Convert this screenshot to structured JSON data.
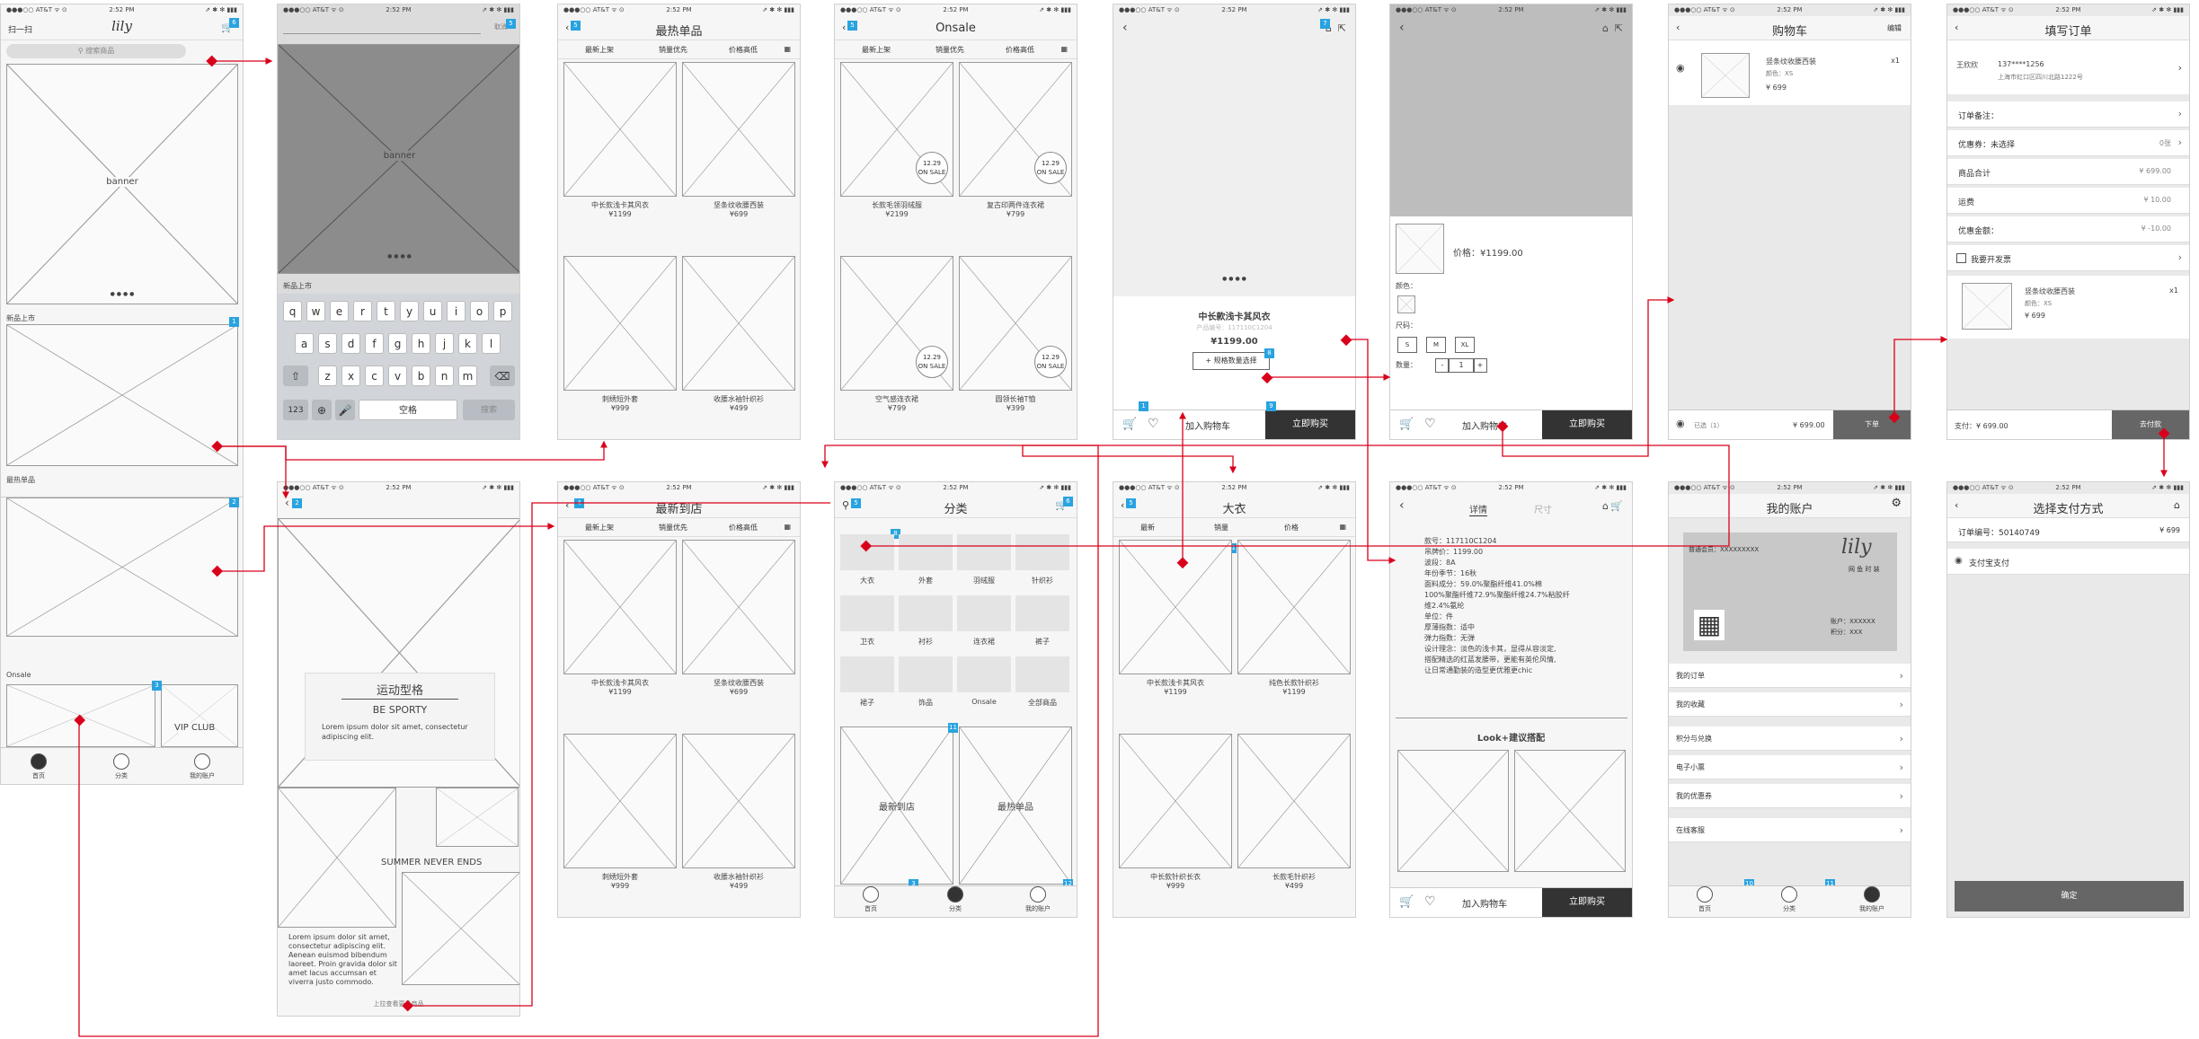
{
  "status": {
    "carrier": "●●●○○ AT&T ᯤ ⊙",
    "time": "2:52 PM",
    "battery": "⇗ ✱ ✻ ▮▮▮"
  },
  "s1": {
    "nav_left": "扫一扫",
    "logo": "lily",
    "search_placeholder": "搜索商品",
    "banner": "banner",
    "sec_new": "新品上市",
    "sec_hot": "最热单品",
    "sec_onsale": "Onsale",
    "vip": "VIP CLUB",
    "tabs": [
      "首页",
      "分类",
      "我的账户"
    ]
  },
  "s2": {
    "banner": "banner",
    "sec_new": "新品上市",
    "search_btn": "搜索",
    "cancel": "取消",
    "keys_r1": [
      "q",
      "w",
      "e",
      "r",
      "t",
      "y",
      "u",
      "i",
      "o",
      "p"
    ],
    "keys_r2": [
      "a",
      "s",
      "d",
      "f",
      "g",
      "h",
      "j",
      "k",
      "l"
    ],
    "keys_r3": [
      "z",
      "x",
      "c",
      "v",
      "b",
      "n",
      "m"
    ],
    "k123": "123",
    "space": "空格"
  },
  "s3": {
    "title": "最热单品",
    "sort": [
      "最新上架",
      "销量优先",
      "价格高低"
    ],
    "items": [
      {
        "name": "中长款浅卡其风衣",
        "price": "¥1199"
      },
      {
        "name": "坚条纹收腰西装",
        "price": "¥699"
      },
      {
        "name": "刺绣短外套",
        "price": "¥999"
      },
      {
        "name": "收腰水袖针织衫",
        "price": "¥499"
      }
    ]
  },
  "s4": {
    "title": "Onsale",
    "sort": [
      "最新上架",
      "销量优先",
      "价格高低"
    ],
    "sale_date": "12.29",
    "sale_label": "ON SALE",
    "items": [
      {
        "name": "长款毛领羽绒服",
        "price": "¥2199"
      },
      {
        "name": "复古印两件连衣裙",
        "price": "¥799"
      },
      {
        "name": "空气感连衣裙",
        "price": "¥799"
      },
      {
        "name": "圆领长袖T恤",
        "price": "¥399"
      }
    ]
  },
  "s5": {
    "product": "中长款浅卡其风衣",
    "code": "产品编号：117110C1204",
    "price": "¥1199.00",
    "spec_btn": "+ 规格数量选择",
    "add_cart": "加入购物车",
    "buy": "立即购买"
  },
  "s6": {
    "price": "价格：¥1199.00",
    "color_label": "颜色：",
    "size_label": "尺码：",
    "sizes": [
      "S",
      "M",
      "XL"
    ],
    "qty_label": "数量：",
    "qty": "1",
    "minus": "-",
    "plus": "+",
    "add_cart": "加入购物车",
    "buy": "立即购买"
  },
  "s7": {
    "title": "购物车",
    "edit": "编辑",
    "item_name": "竖条纹收腰西装",
    "item_spec": "颜色：XS",
    "item_qty": "x1",
    "item_price": "¥ 699",
    "selected": "已选（1）",
    "total": "¥ 699.00",
    "order_btn": "下单"
  },
  "s8": {
    "title": "填写订单",
    "receiver": "王欣欣",
    "phone": "137****1256",
    "address": "上海市虹口区四川北路1222号",
    "rows": [
      {
        "k": "订单备注：",
        "v": ""
      },
      {
        "k": "优惠券：未选择",
        "v": "0张"
      },
      {
        "k": "商品合计",
        "v": "¥ 699.00"
      },
      {
        "k": "运费",
        "v": "¥ 10.00"
      },
      {
        "k": "优惠金额：",
        "v": "¥ -10.00"
      }
    ],
    "invoice": "我要开发票",
    "item_name": "竖条纹收腰西装",
    "item_spec": "颜色：XS",
    "item_qty": "x1",
    "item_price": "¥ 699",
    "pay_total": "支付：¥ 699.00",
    "pay_btn": "去付款"
  },
  "s9": {
    "title": "最新到店",
    "sort": [
      "最新上架",
      "销量优先",
      "价格高低"
    ],
    "items": [
      {
        "name": "中长款浅卡其风衣",
        "price": "¥1199"
      },
      {
        "name": "坚条纹收腰西装",
        "price": "¥699"
      },
      {
        "name": "刺绣短外套",
        "price": "¥999"
      },
      {
        "name": "收腰水袖针织衫",
        "price": "¥499"
      }
    ]
  },
  "s10": {
    "title": "运动型格",
    "subtitle": "BE SPORTY",
    "lorem1": "Lorem ipsum dolor sit amet, consectetur adipiscing elit.",
    "summer": "SUMMER NEVER ENDS",
    "lorem2": "Lorem ipsum dolor sit amet, consectetur adipiscing elit. Aenean euismod bibendum laoreet. Proin gravida dolor sit amet lacus accumsan et viverra justo commodo.",
    "more": "上拉查看更多商品"
  },
  "s11": {
    "title": "分类",
    "cats": [
      "大衣",
      "外套",
      "羽绒服",
      "针织衫",
      "卫衣",
      "衬衫",
      "连衣裙",
      "裤子",
      "裙子",
      "饰品",
      "Onsale",
      "全部商品"
    ],
    "promo1": "最新到店",
    "promo2": "最热单品",
    "tabs": [
      "首页",
      "分类",
      "我的账户"
    ]
  },
  "s12": {
    "title": "大衣",
    "sort": [
      "最新",
      "销量",
      "价格"
    ],
    "items": [
      {
        "name": "中长款浅卡其风衣",
        "price": "¥1199"
      },
      {
        "name": "纯色长款针织衫",
        "price": "¥1199"
      },
      {
        "name": "中长款针织长衣",
        "price": "¥999"
      },
      {
        "name": "长款毛针织衫",
        "price": "¥499"
      }
    ]
  },
  "s13": {
    "tab1": "详情",
    "tab2": "尺寸",
    "details": [
      "款号：117110C1204",
      "吊牌价：1199.00",
      "波段：8A",
      "年份季节：16秋",
      "面料成分：59.0%聚酯纤维41.0%棉",
      "100%聚酯纤维72.9%聚酯纤维24.7%粘胶纤",
      "维2.4%氨纶",
      "单位：件",
      "厚薄指数：适中",
      "弹力指数：无弹",
      "设计理念：淡色的浅卡其，显得从容淡定,",
      "搭配精选的红蓝发腰带，更能有英伦风情,",
      "让日常通勤装的造型更优雅更chic"
    ],
    "look": "Look+建议搭配",
    "add_cart": "加入购物车",
    "buy": "立即购买"
  },
  "s14": {
    "title": "我的账户",
    "member": "普通会员：XXXXXXXXX",
    "logo": "lily",
    "logo_sub": "网 鱼 时 装",
    "acct": "账户：XXXXXX",
    "points": "积分：XXX",
    "menu": [
      "我的订单",
      "我的收藏",
      "积分与兑换",
      "电子小票",
      "我的优惠券",
      "在线客服"
    ],
    "tabs": [
      "首页",
      "分类",
      "我的账户"
    ]
  },
  "s15": {
    "title": "选择支付方式",
    "order_no": "订单编号：50140749",
    "amount": "¥ 699",
    "method": "支付宝支付",
    "confirm": "确定"
  }
}
